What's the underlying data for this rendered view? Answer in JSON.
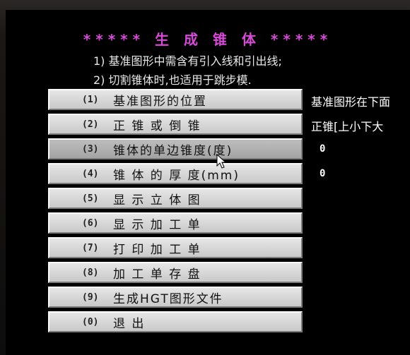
{
  "header": {
    "title": "***** 生 成 锥 体 *****",
    "note1": "1) 基准图形中需含有引入线和引出线;",
    "note2": "2) 切割锥体时,也适用于跳步模."
  },
  "menu": [
    {
      "key": "(1)",
      "label": "基准图形的位置"
    },
    {
      "key": "(2)",
      "label": "正 锥 或 倒 锥"
    },
    {
      "key": "(3)",
      "label": "锥体的单边锥度(度)"
    },
    {
      "key": "(4)",
      "label": "锥 体 的 厚 度(mm)"
    },
    {
      "key": "(5)",
      "label": "显 示 立 体 图"
    },
    {
      "key": "(6)",
      "label": "显 示 加 工 单"
    },
    {
      "key": "(7)",
      "label": "打 印 加 工 单"
    },
    {
      "key": "(8)",
      "label": "加 工 单 存 盘"
    },
    {
      "key": "(9)",
      "label": "生成HGT图形文件"
    },
    {
      "key": "(0)",
      "label": "退      出"
    }
  ],
  "values": {
    "position": "基准图形在下面",
    "cone_type": "正锥[上小下大",
    "taper": "0",
    "thickness": "0"
  },
  "colors": {
    "title": "#d74ad7",
    "button": "#d6d6d6",
    "text": "#e8e8e8"
  }
}
